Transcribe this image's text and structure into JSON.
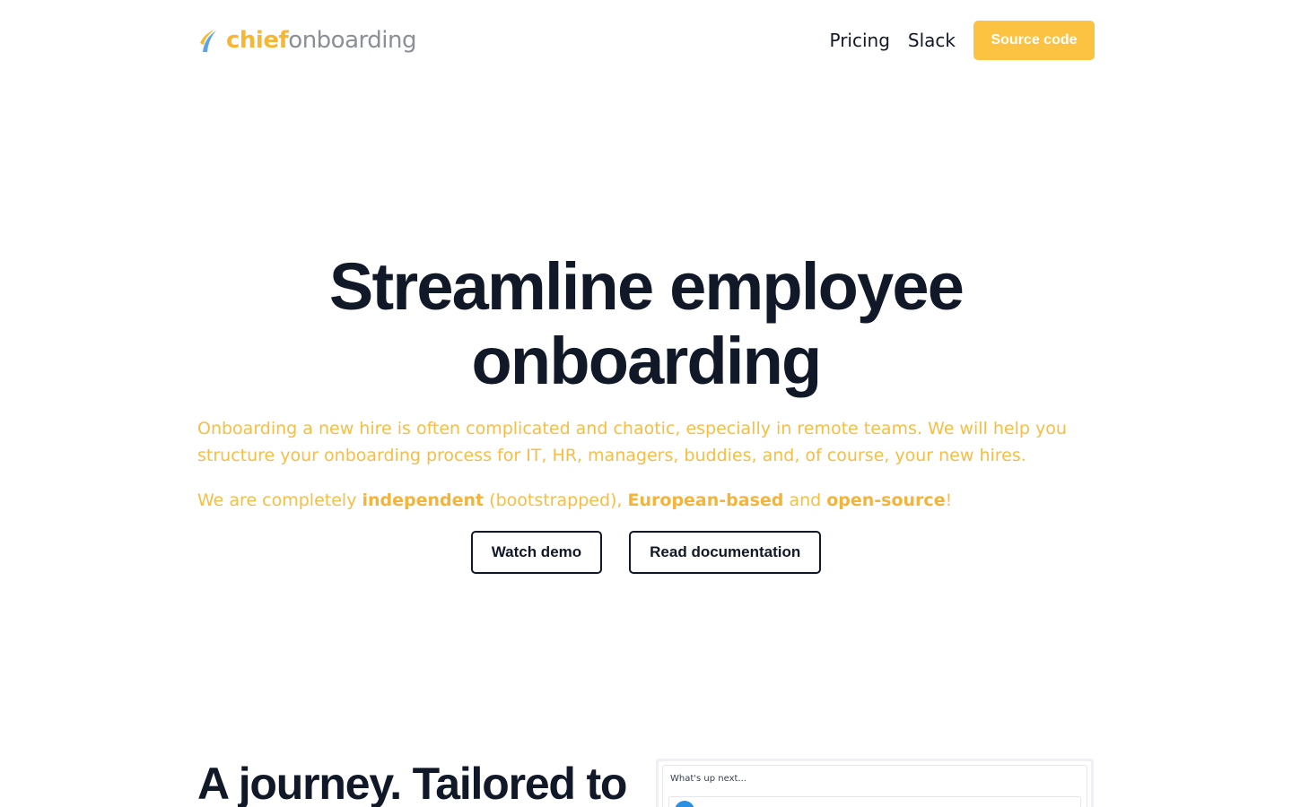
{
  "header": {
    "logo": {
      "brand_primary": "chief",
      "brand_secondary": "onboarding",
      "icon": "flame-swoosh-icon"
    },
    "nav": [
      {
        "label": "Pricing"
      },
      {
        "label": "Slack"
      }
    ],
    "source_button": "Source code"
  },
  "hero": {
    "title": "Streamline employee onboarding",
    "description": "Onboarding a new hire is often complicated and chaotic, especially in remote teams. We will help you structure your onboarding process for IT, HR, managers, buddies, and, of course, your new hires.",
    "tagline": {
      "p1": "We are completely ",
      "b1": "independent",
      "p2": " (bootstrapped), ",
      "b2": "European-based",
      "p3": " and ",
      "b3": "open-source",
      "p4": "!"
    },
    "buttons": {
      "watch_demo": "Watch demo",
      "read_docs": "Read documentation"
    }
  },
  "journey": {
    "title": "A journey. Tailored to",
    "preview_heading": "What's up next..."
  },
  "colors": {
    "accent": "#fcc242",
    "accent_text": "#f7bd45",
    "logo_gray": "#8a8f98",
    "heading": "#111827",
    "avatar_blue": "#2b8fe5"
  }
}
